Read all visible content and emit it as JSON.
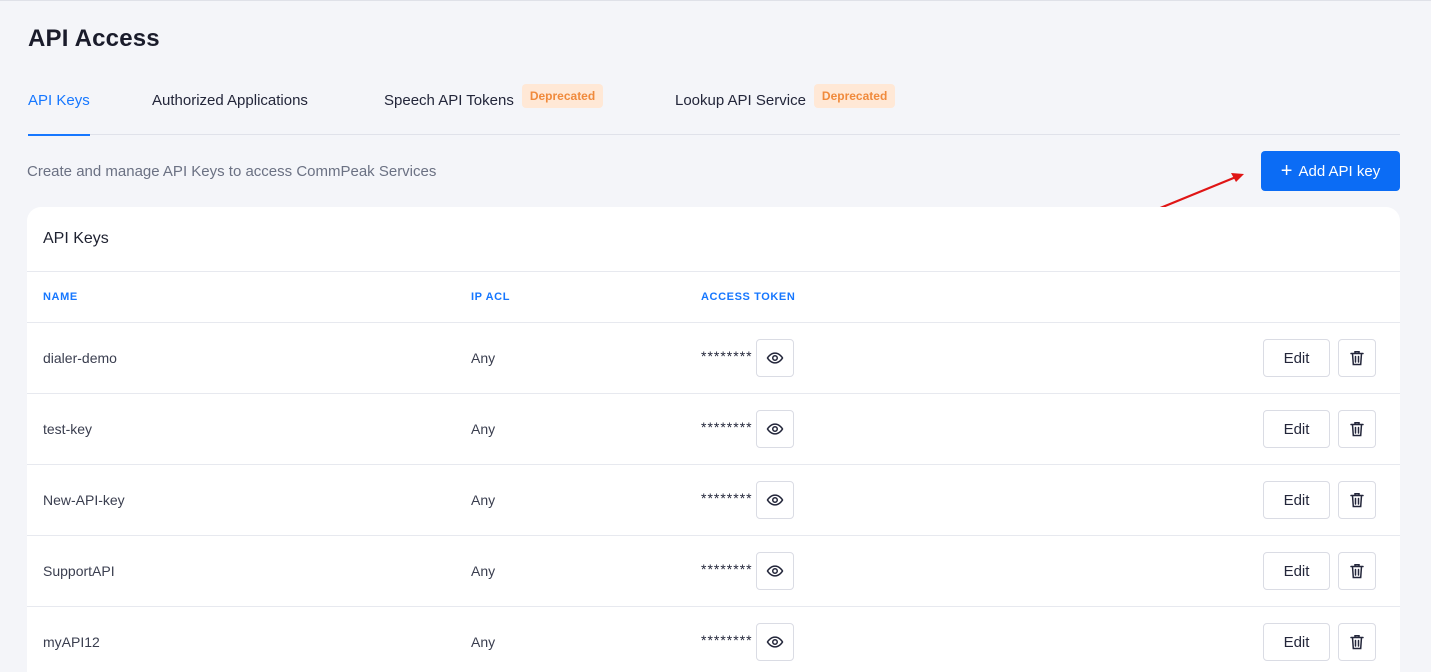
{
  "page": {
    "title": "API Access",
    "subtitle": "Create and manage API Keys to access CommPeak Services"
  },
  "tabs": [
    {
      "label": "API Keys",
      "active": true,
      "badge": ""
    },
    {
      "label": "Authorized Applications",
      "active": false,
      "badge": ""
    },
    {
      "label": "Speech API Tokens",
      "active": false,
      "badge": "Deprecated"
    },
    {
      "label": "Lookup API Service",
      "active": false,
      "badge": "Deprecated"
    }
  ],
  "add_button": {
    "icon": "plus-icon",
    "label": "Add API key"
  },
  "card": {
    "title": "API Keys",
    "columns": {
      "name": "NAME",
      "ip_acl": "IP ACL",
      "access_token": "ACCESS TOKEN"
    },
    "rows": [
      {
        "name": "dialer-demo",
        "ip_acl": "Any",
        "token": "********",
        "edit_label": "Edit"
      },
      {
        "name": "test-key",
        "ip_acl": "Any",
        "token": "********",
        "edit_label": "Edit"
      },
      {
        "name": "New-API-key",
        "ip_acl": "Any",
        "token": "********",
        "edit_label": "Edit"
      },
      {
        "name": "SupportAPI",
        "ip_acl": "Any",
        "token": "********",
        "edit_label": "Edit"
      },
      {
        "name": "myAPI12",
        "ip_acl": "Any",
        "token": "********",
        "edit_label": "Edit"
      }
    ]
  },
  "colors": {
    "accent": "#1677ff",
    "primary_button": "#0b6cf5",
    "badge_bg": "#ffe8d6",
    "badge_text": "#f08a3c",
    "annotation_arrow": "#e01515",
    "page_bg": "#f4f5f9"
  }
}
